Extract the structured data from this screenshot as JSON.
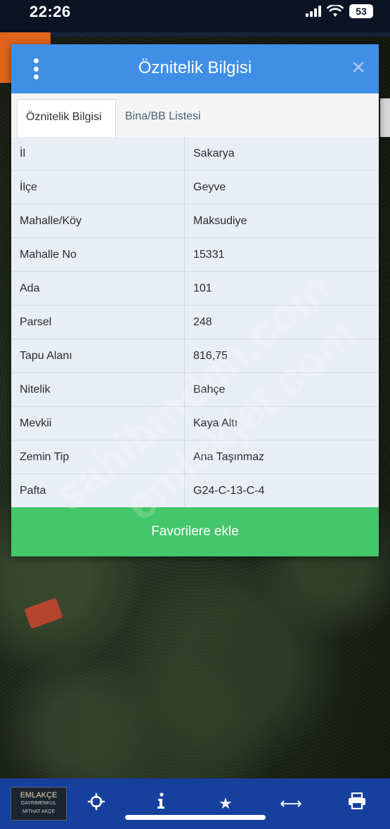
{
  "status": {
    "time": "22:26",
    "battery": "53"
  },
  "modal": {
    "title": "Öznitelik Bilgisi",
    "tabs": [
      "Öznitelik Bilgisi",
      "Bina/BB Listesi"
    ],
    "rows": [
      {
        "key": "İl",
        "value": "Sakarya"
      },
      {
        "key": "İlçe",
        "value": "Geyve"
      },
      {
        "key": "Mahalle/Köy",
        "value": "Maksudiye"
      },
      {
        "key": "Mahalle No",
        "value": "15331"
      },
      {
        "key": "Ada",
        "value": "101"
      },
      {
        "key": "Parsel",
        "value": "248"
      },
      {
        "key": "Tapu Alanı",
        "value": "816,75"
      },
      {
        "key": "Nitelik",
        "value": "Bahçe"
      },
      {
        "key": "Mevkii",
        "value": "Kaya Altı"
      },
      {
        "key": "Zemin Tip",
        "value": "Ana Taşınmaz"
      },
      {
        "key": "Pafta",
        "value": "G24-C-13-C-4"
      }
    ],
    "favorite_button": "Favorilere ekle"
  },
  "watermarks": [
    "sahibinden.com",
    "emlakjet.com"
  ],
  "logo": {
    "line1": "EMLAKÇE",
    "line2": "GAYRİMENKUL",
    "line3": "MİTHAT AKÇE"
  },
  "bottom_bar": {
    "icons": [
      "crosshair-icon",
      "info-icon",
      "star-icon",
      "arrows-horizontal-icon",
      "printer-icon"
    ]
  }
}
